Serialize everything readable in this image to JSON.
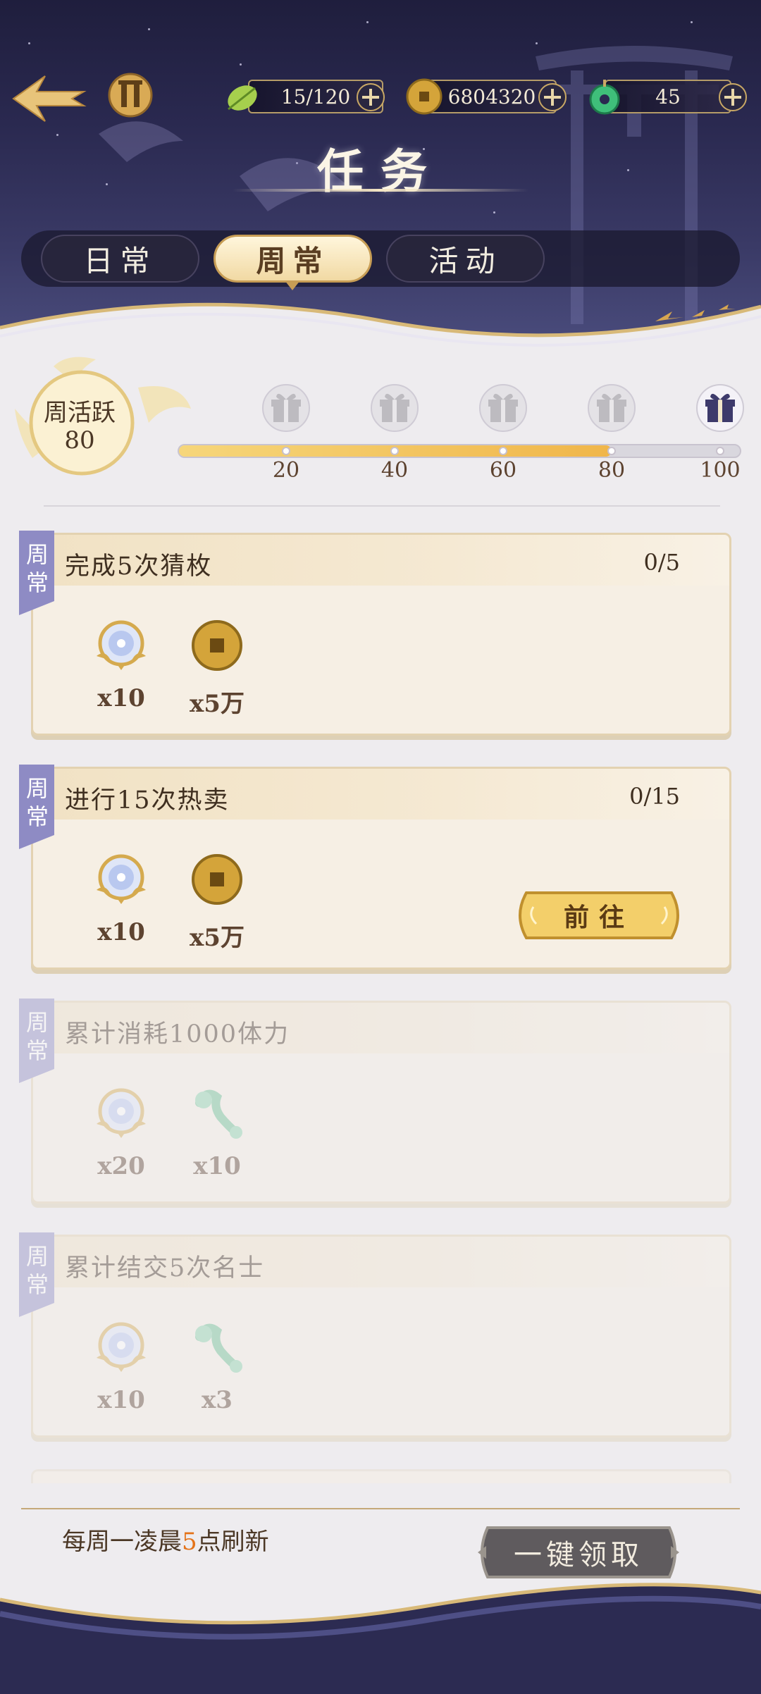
{
  "header": {
    "title": "任务",
    "resources": [
      {
        "icon": "stamina-leaf-icon",
        "value": "15/120"
      },
      {
        "icon": "copper-coin-icon",
        "value": "6804320"
      },
      {
        "icon": "jade-icon",
        "value": "45"
      }
    ]
  },
  "tabs": [
    {
      "label": "日常",
      "active": false
    },
    {
      "label": "周常",
      "active": true
    },
    {
      "label": "活动",
      "active": false
    }
  ],
  "activity": {
    "label": "周活跃",
    "value": "80",
    "progress_fraction": 0.8,
    "milestones": [
      {
        "label": "20",
        "state": "claimed"
      },
      {
        "label": "40",
        "state": "claimed"
      },
      {
        "label": "60",
        "state": "claimed"
      },
      {
        "label": "80",
        "state": "claimed"
      },
      {
        "label": "100",
        "state": "locked"
      }
    ]
  },
  "tasks": [
    {
      "tag": "周常",
      "title": "完成5次猜枚",
      "progress": "0/5",
      "rewards": [
        {
          "icon": "crystal-medallion-icon",
          "qty": "x10"
        },
        {
          "icon": "copper-coin-icon",
          "qty": "x5万"
        }
      ],
      "action": null,
      "completed": false
    },
    {
      "tag": "周常",
      "title": "进行15次热卖",
      "progress": "0/15",
      "rewards": [
        {
          "icon": "crystal-medallion-icon",
          "qty": "x10"
        },
        {
          "icon": "copper-coin-icon",
          "qty": "x5万"
        }
      ],
      "action": "前往",
      "completed": false
    },
    {
      "tag": "周常",
      "title": "累计消耗1000体力",
      "progress": "",
      "rewards": [
        {
          "icon": "crystal-medallion-icon",
          "qty": "x20"
        },
        {
          "icon": "jade-ruyi-icon",
          "qty": "x10"
        }
      ],
      "action": null,
      "completed": true
    },
    {
      "tag": "周常",
      "title": "累计结交5次名士",
      "progress": "",
      "rewards": [
        {
          "icon": "crystal-medallion-icon",
          "qty": "x10"
        },
        {
          "icon": "jade-ruyi-icon",
          "qty": "x3"
        }
      ],
      "action": null,
      "completed": true
    }
  ],
  "footer": {
    "refresh_prefix": "每周一凌晨",
    "refresh_hour": "5",
    "refresh_suffix": "点刷新",
    "claim_all_label": "一键领取"
  },
  "colors": {
    "header_bg": "#2a2950",
    "gold": "#c79d55",
    "highlight": "#e4731a",
    "tag_purple": "#8e8bc4"
  }
}
